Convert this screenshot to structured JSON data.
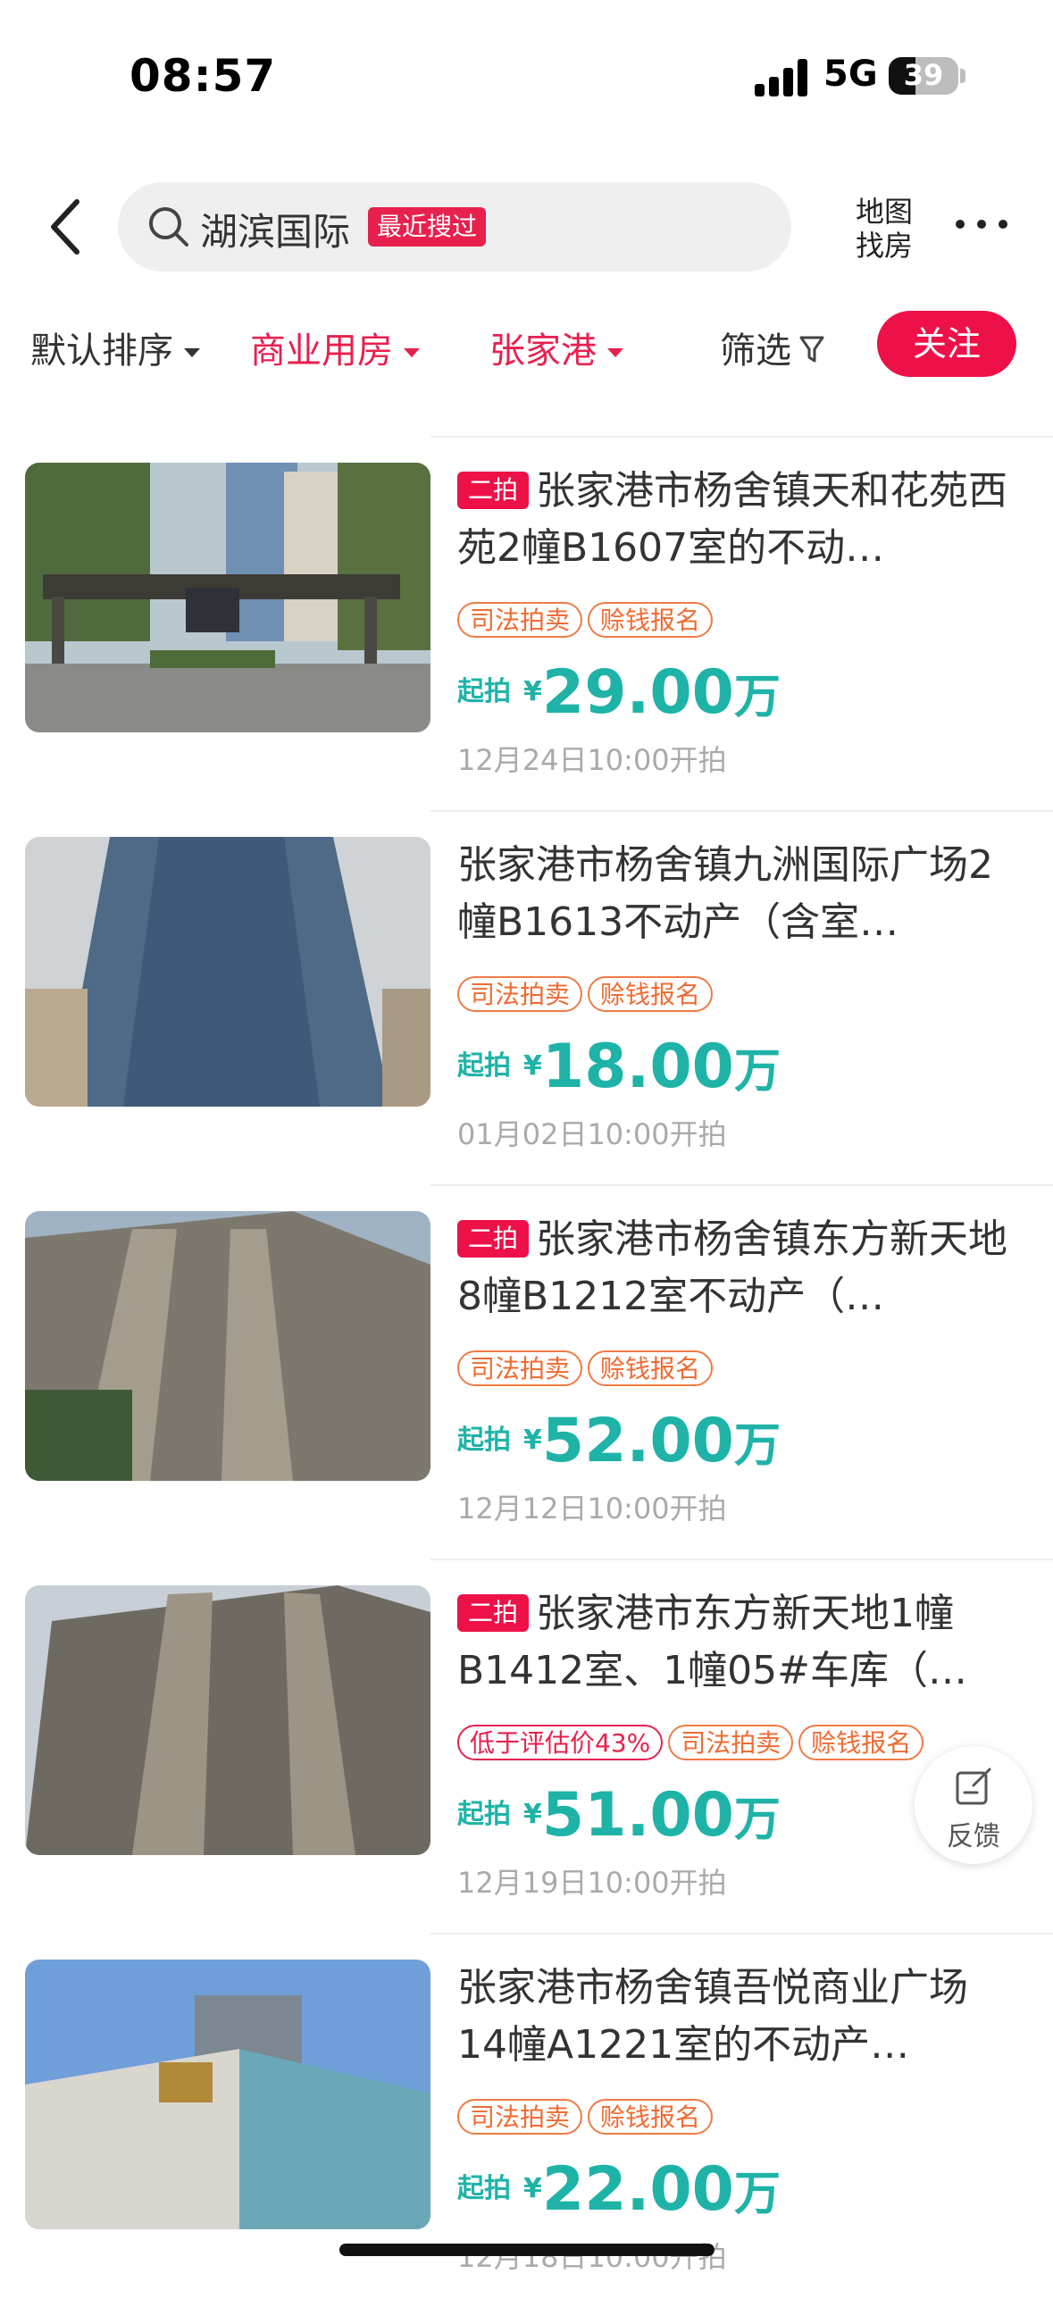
{
  "status_bar": {
    "time": "08:57",
    "network": "5G",
    "battery": "39",
    "battery_level_percent": 39
  },
  "header": {
    "search_text": "湖滨国际",
    "recent_badge": "最近搜过",
    "map_label_line1": "地图",
    "map_label_line2": "找房"
  },
  "filters": {
    "default_sort": "默认排序",
    "property_type": "商业用房",
    "area": "张家港",
    "screen": "筛选",
    "follow": "关注"
  },
  "listings": [
    {
      "round": "二拍",
      "title": "张家港市杨舍镇天和花苑西苑2幢B1607室的不动…",
      "tags": [
        "司法拍卖",
        "赊钱报名"
      ],
      "price_label": "起拍",
      "currency": "¥",
      "price": "29.00",
      "unit": "万",
      "date": "12月24日10:00开拍"
    },
    {
      "round": "",
      "title": "张家港市杨舍镇九洲国际广场2幢B1613不动产（含室…",
      "tags": [
        "司法拍卖",
        "赊钱报名"
      ],
      "price_label": "起拍",
      "currency": "¥",
      "price": "18.00",
      "unit": "万",
      "date": "01月02日10:00开拍"
    },
    {
      "round": "二拍",
      "title": "张家港市杨舍镇东方新天地8幢B1212室不动产（…",
      "tags": [
        "司法拍卖",
        "赊钱报名"
      ],
      "price_label": "起拍",
      "currency": "¥",
      "price": "52.00",
      "unit": "万",
      "date": "12月12日10:00开拍"
    },
    {
      "round": "二拍",
      "title": "张家港市东方新天地1幢B1412室、1幢05#车库（…",
      "discount": "低于评估价43%",
      "tags": [
        "司法拍卖",
        "赊钱报名"
      ],
      "price_label": "起拍",
      "currency": "¥",
      "price": "51.00",
      "unit": "万",
      "date": "12月19日10:00开拍"
    },
    {
      "round": "",
      "title": "张家港市杨舍镇吾悦商业广场14幢A1221室的不动产…",
      "tags": [
        "司法拍卖",
        "赊钱报名"
      ],
      "price_label": "起拍",
      "currency": "¥",
      "price": "22.00",
      "unit": "万",
      "date": "12月18日10:00开拍"
    }
  ],
  "feedback_label": "反馈",
  "colors": {
    "accent": "#ed1148",
    "price": "#1fb3a8",
    "tag": "#f06a30"
  }
}
